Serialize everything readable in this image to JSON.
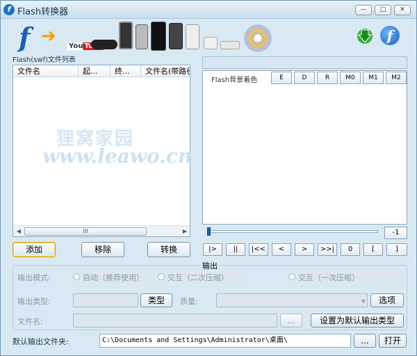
{
  "window": {
    "title": "Flash转换器",
    "controls": {
      "minimize": "—",
      "maximize": "□",
      "close": "✕"
    }
  },
  "banner": {
    "youtube_left": "You",
    "youtube_right": "Tube"
  },
  "file_list": {
    "label": "Flash(swf)文件列表",
    "columns": [
      "文件名",
      "起...",
      "终...",
      "文件名(带路径)"
    ],
    "scroll_thumb": "III"
  },
  "list_buttons": {
    "add": "添加",
    "remove": "移除",
    "convert": "转换"
  },
  "watermark": {
    "text": "狸窝家园",
    "url": "www.leawo.cn"
  },
  "preview": {
    "bg_color_label": "Flash背景着色",
    "toolbar": [
      "E",
      "D",
      "R",
      "M0",
      "M1",
      "M2"
    ],
    "frame_value": "-1",
    "playback": [
      "|>",
      "||",
      "|<<",
      "<",
      ">",
      ">>|",
      "0",
      "[",
      "]"
    ]
  },
  "output": {
    "group_title": "输出",
    "mode_label": "输出模式:",
    "mode_options": [
      "自动（推荐使用）",
      "交互（二次压缩）",
      "交互（一次压缩）"
    ],
    "type_label": "输出类型:",
    "type_button": "类型",
    "quality_label": "质量:",
    "options_button": "选项",
    "filename_label": "文件名:",
    "browse_small": "...",
    "set_default_button": "设置为默认输出类型"
  },
  "default_output": {
    "label": "默认输出文件夹:",
    "path": "C:\\Documents and Settings\\Administrator\\桌面\\",
    "browse": "...",
    "open": "打开"
  }
}
